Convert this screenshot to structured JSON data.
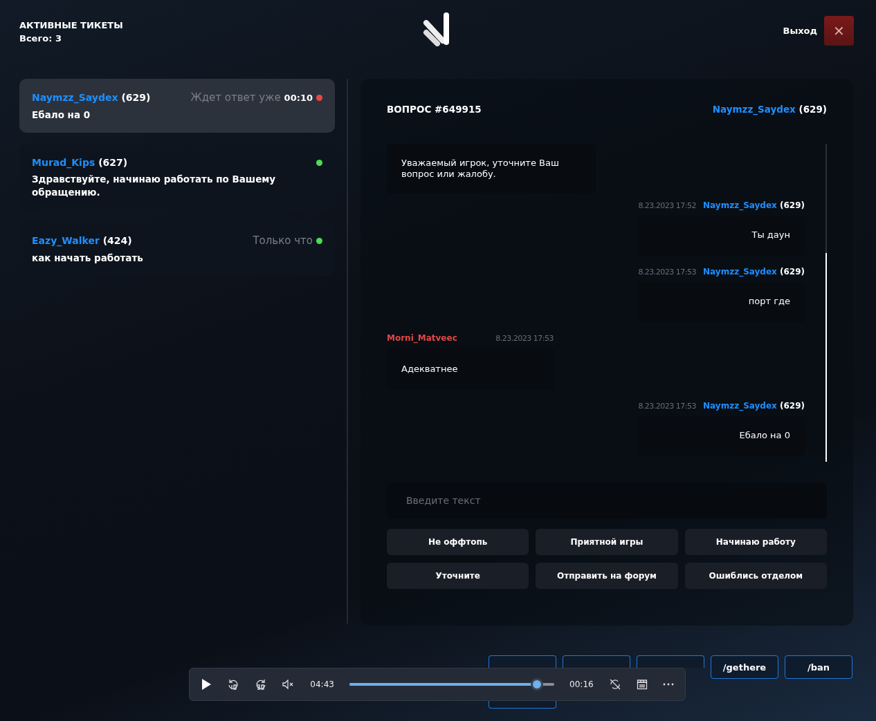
{
  "header": {
    "title": "АКТИВНЫЕ ТИКЕТЫ",
    "total": "Всего: 3",
    "exit_label": "Выход",
    "close_icon": "✕"
  },
  "tickets": [
    {
      "name": "Naymzz_Saydex",
      "number": "(629)",
      "status": "Ждет ответ уже **00:10**",
      "color": "#ef4444",
      "text": "Ебало на 0",
      "selected": true
    },
    {
      "name": "Murad_Kips",
      "number": "(627)",
      "color": "#4ade50",
      "text": "Здравствуйте, начинаю работать по Вашему обращению.",
      "selected": false
    },
    {
      "name": "Eazy_Walker",
      "number": "(424)",
      "status": "Только что",
      "color": "#4ade50",
      "text": "как начать работать",
      "selected": false
    }
  ],
  "chat": {
    "title": "ВОПРОС #649915",
    "user_name": "Naymzz_Saydex",
    "user_number": "(629)",
    "messages": [
      {
        "kind": "incoming",
        "text": "Уважаемый игрок, уточните Ваш вопрос или жалобу."
      },
      {
        "kind": "outgoing",
        "date": "8.23.2023 17:52",
        "author": "Naymzz_Saydex",
        "number": "(629)",
        "color": "#1e8fff",
        "text": "Ты даун"
      },
      {
        "kind": "outgoing",
        "date": "8.23.2023 17:53",
        "author": "Naymzz_Saydex",
        "number": "(629)",
        "color": "#1e8fff",
        "text": "порт где"
      },
      {
        "kind": "incoming",
        "date": "8.23.2023 17:53",
        "author": "Morni_Matveec",
        "color": "#e04848",
        "text": "Адекватнее"
      },
      {
        "kind": "outgoing",
        "date": "8.23.2023 17:53",
        "author": "Naymzz_Saydex",
        "number": "(629)",
        "color": "#1e8fff",
        "text": "Ебало на 0"
      }
    ],
    "input": {
      "placeholder": "Введите текст"
    },
    "quick_replies": [
      "Не оффтопь",
      "Приятной игры",
      "Начинаю работу",
      "Уточните",
      "Отправить на форум",
      "Ошиблись отделом"
    ]
  },
  "commands": [
    {
      "covered": true
    },
    {
      "covered": true
    },
    {
      "covered": true
    },
    {
      "covered": false,
      "label": "/gethere"
    },
    {
      "covered": false,
      "label": "/ban"
    },
    {
      "covered": true
    }
  ],
  "player": {
    "elapsed": "04:43",
    "level": 0.915,
    "remaining": "00:16"
  }
}
